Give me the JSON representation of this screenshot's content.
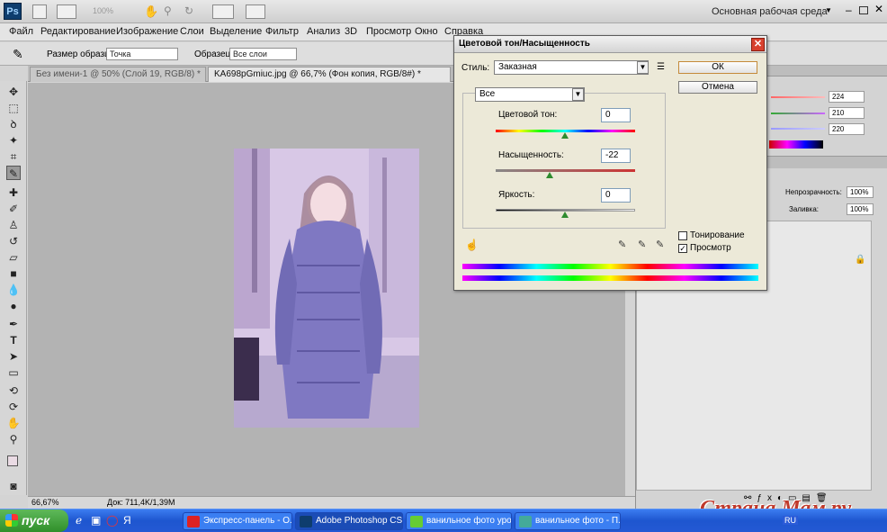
{
  "app": {
    "logo": "Ps",
    "zoom_display": "100%",
    "workspace": "Основная рабочая среда"
  },
  "menu": [
    "Файл",
    "Редактирование",
    "Изображение",
    "Слои",
    "Выделение",
    "Фильтр",
    "Анализ",
    "3D",
    "Просмотр",
    "Окно",
    "Справка"
  ],
  "options_bar": {
    "sample_size_label": "Размер образца:",
    "sample_size_value": "Точка",
    "sample_label": "Образец:",
    "sample_value": "Все слои"
  },
  "tabs": [
    {
      "label": "Без имени-1 @ 50% (Слой 19, RGB/8) *",
      "active": false
    },
    {
      "label": "KA698pGmiuc.jpg @ 66,7% (Фон копия, RGB/8#) *",
      "active": true
    }
  ],
  "status": {
    "zoom": "66,67%",
    "doc": "Док: 711,4K/1,39M"
  },
  "right_panel": {
    "color_values": [
      "224",
      "210",
      "220"
    ],
    "opacity_label": "Непрозрачность:",
    "opacity_value": "100%",
    "fill_label": "Заливка:",
    "fill_value": "100%"
  },
  "dialog": {
    "title": "Цветовой тон/Насыщенность",
    "style_label": "Стиль:",
    "style_value": "Заказная",
    "ok": "ОК",
    "cancel": "Отмена",
    "channel": "Все",
    "hue_label": "Цветовой тон:",
    "hue_value": "0",
    "saturation_label": "Насыщенность:",
    "saturation_value": "-22",
    "lightness_label": "Яркость:",
    "lightness_value": "0",
    "colorize_label": "Тонирование",
    "colorize_checked": false,
    "preview_label": "Просмотр",
    "preview_checked": true
  },
  "taskbar": {
    "start": "пуск",
    "items": [
      "Экспресс-панель - О...",
      "Adobe Photoshop CS...",
      "ванильное фото урок",
      "ванильное фото - П..."
    ],
    "lang": "RU"
  },
  "watermark": "Страна Мам.ру"
}
